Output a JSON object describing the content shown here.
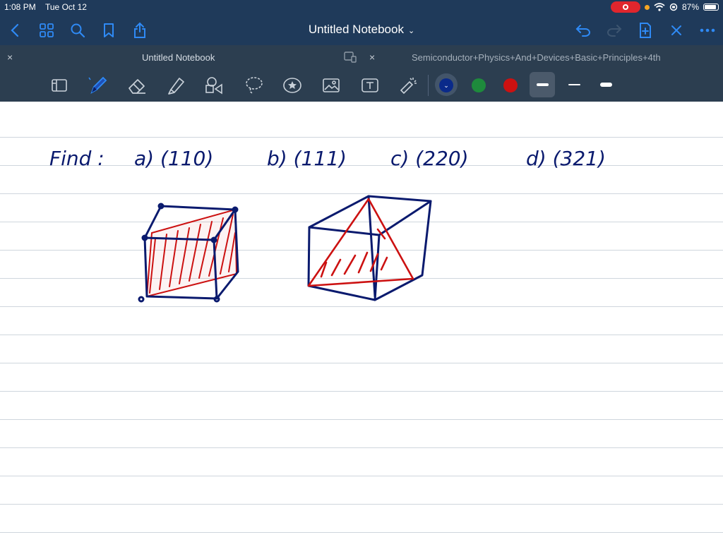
{
  "status": {
    "time": "1:08 PM",
    "date": "Tue Oct 12",
    "battery": "87%",
    "battery_level": 0.87
  },
  "nav": {
    "title": "Untitled Notebook",
    "icons": [
      "back-icon",
      "grid-icon",
      "search-icon",
      "bookmark-icon",
      "share-icon",
      "undo-icon",
      "redo-icon",
      "add-page-icon",
      "close-icon",
      "more-icon"
    ]
  },
  "tabs": [
    {
      "label": "Untitled Notebook"
    },
    {
      "label": "Semiconductor+Physics+And+Devices+Basic+Principles+4th"
    }
  ],
  "toolbar": {
    "tools": [
      "page-layout-icon",
      "pen-icon",
      "eraser-icon",
      "highlighter-icon",
      "shapes-icon",
      "lasso-icon",
      "sticker-icon",
      "image-icon",
      "text-icon",
      "laser-pointer-icon"
    ],
    "colors": [
      "#0a2a8a",
      "#1e8a3c",
      "#cc1111"
    ],
    "selected_color": "#0a2a8a",
    "selected_stroke": "medium"
  },
  "notes": {
    "find": "Find :",
    "items": [
      {
        "label": "a) (110)"
      },
      {
        "label": "b) (111)"
      },
      {
        "label": "c) (220)"
      },
      {
        "label": "d) (321)"
      }
    ]
  }
}
